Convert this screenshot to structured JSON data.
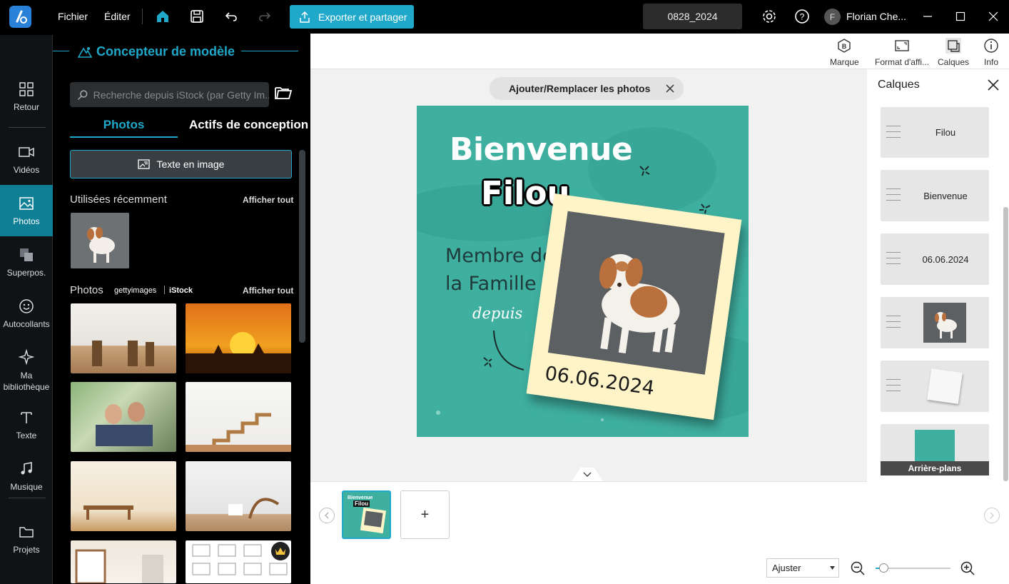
{
  "titlebar": {
    "menu": [
      "Fichier",
      "Éditer"
    ],
    "export_label": "Exporter et partager",
    "project_name": "0828_2024",
    "user_initial": "F",
    "user_name": "Florian Che..."
  },
  "panel": {
    "title": "Concepteur de modèle",
    "search_placeholder": "Recherche depuis iStock (par Getty Im...",
    "tabs": [
      "Photos",
      "Actifs de conception"
    ],
    "text_to_image": "Texte en image",
    "recent_title": "Utilisées récemment",
    "show_all": "Afficher tout",
    "photos_title": "Photos",
    "getty": "gettyimages",
    "istock": "iStock"
  },
  "rail": [
    {
      "label": "Retour",
      "icon": "grid-icon"
    },
    {
      "label": "Vidéos",
      "icon": "video-icon"
    },
    {
      "label": "Photos",
      "icon": "photo-icon"
    },
    {
      "label": "Superpos.",
      "icon": "overlay-icon"
    },
    {
      "label": "Autocollants",
      "icon": "sticker-icon"
    },
    {
      "label": "Ma bibliothèque",
      "icon": "sparkle-icon"
    },
    {
      "label": "Texte",
      "icon": "text-icon"
    },
    {
      "label": "Musique",
      "icon": "music-icon"
    },
    {
      "label": "Projets",
      "icon": "folder-icon"
    }
  ],
  "toolbar": {
    "items": [
      "Marque",
      "Format d'affi...",
      "Calques",
      "Info"
    ]
  },
  "canvas": {
    "replace_label": "Ajouter/Remplacer les photos",
    "title1": "Bienvenue",
    "title2": "Filou",
    "body1": "Membre de",
    "body2": "la Famille",
    "body3": "depuis",
    "date": "06.06.2024"
  },
  "layers": {
    "title": "Calques",
    "items": [
      "Filou",
      "Bienvenue",
      "06.06.2024"
    ],
    "backgrounds_label": "Arrière-plans"
  },
  "timeline": {
    "thumb_t1": "Bienvenue",
    "thumb_t2": "Filou",
    "add": "+"
  },
  "zoom": {
    "fit_label": "Ajuster",
    "level": 0.1
  },
  "colors": {
    "accent": "#1fa8c9",
    "canvas_bg": "#3fb0a0",
    "frame": "#fff4c8",
    "rail_active": "#0e7f95"
  }
}
